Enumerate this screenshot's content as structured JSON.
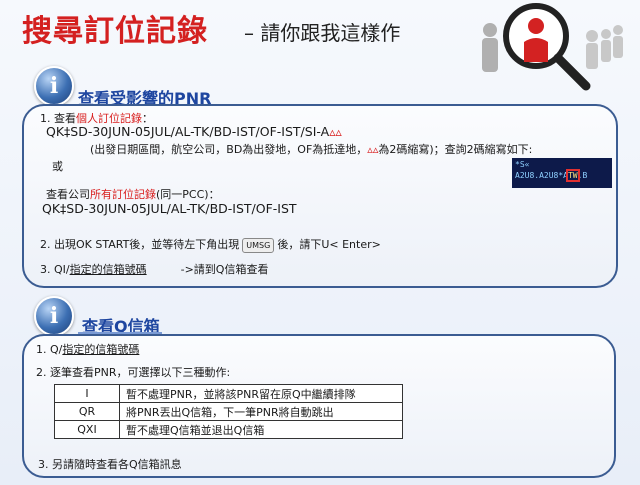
{
  "header": {
    "title": "搜尋訂位記錄",
    "subtitle": "– 請你跟我這樣作"
  },
  "section1": {
    "icon": "info-icon",
    "icon_glyph": "i",
    "title": "查看受影響的PNR",
    "line1_prefix": "1. 查看",
    "line1_red": "個人訂位記錄",
    "line1_suffix": "：",
    "cmd1": "QK‡SD-30JUN-05JUL/AL-TK/BD-IST/OF-IST/SI-A",
    "cmd1_red": "▵▵",
    "note1_a": "(出發日期區間，航空公司，BD為出發地，OF為抵達地，",
    "note1_red": "▵▵",
    "note1_b": "為2碼縮寫)；查詢2碼縮寫如下:",
    "or_label": "或",
    "terminal_line1": "*S«",
    "terminal_line2_a": "A2U8.A2U8*A",
    "terminal_line2_hl": "TW",
    "terminal_line2_b": ".B",
    "line2_prefix": "查看公司",
    "line2_red": "所有訂位記錄",
    "line2_suffix": "(同一PCC)：",
    "cmd2": "QK‡SD-30JUN-05JUL/AL-TK/BD-IST/OF-IST",
    "step2_a": "2. 出現OK START後，並等待左下角出現",
    "step2_key": "UMSG",
    "step2_b": "後，請下U< Enter>",
    "step3_a": "3. QI/",
    "step3_u": "指定的信箱號碼",
    "step3_b": "->請到Q信箱查看"
  },
  "section2": {
    "icon": "info-icon",
    "icon_glyph": "i",
    "title": "查看Q信箱",
    "item1_a": "1.  Q/",
    "item1_u": "指定的信箱號碼",
    "item2": "2.  逐筆查看PNR，可選擇以下三種動作:",
    "actions": [
      {
        "key": "I",
        "desc": "暫不處理PNR，並將該PNR留在原Q中繼續排隊"
      },
      {
        "key": "QR",
        "desc": "將PNR丟出Q信箱，下一筆PNR將自動跳出"
      },
      {
        "key": "QXI",
        "desc": "暫不處理Q信箱並退出Q信箱"
      }
    ],
    "item3": "3. 另請隨時查看各Q信箱訊息"
  },
  "colors": {
    "title_red": "#d42020",
    "accent_blue": "#1e46a0",
    "panel_border": "#3b5c92"
  }
}
